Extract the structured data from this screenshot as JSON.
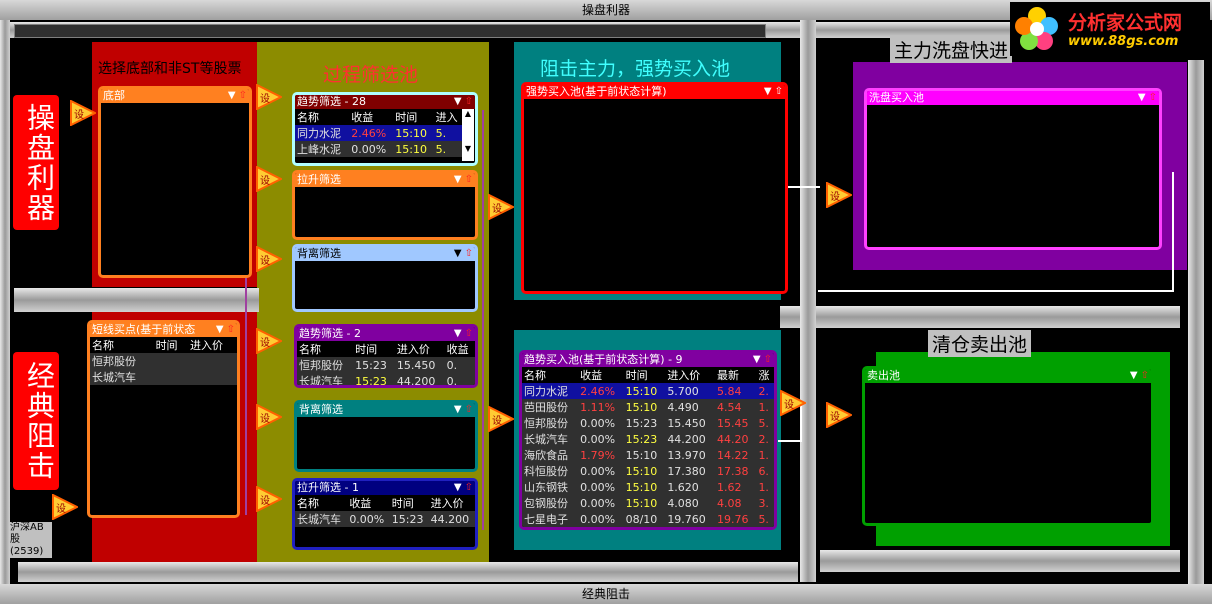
{
  "title": "操盘利器",
  "bottom_title": "经典阻击",
  "logo": {
    "text": "分析家公式网",
    "url": "www.88gs.com"
  },
  "side_labels": {
    "top": "操盘利器",
    "bottom": "经典阻击"
  },
  "section_titles": {
    "base": "选择底部和非ST等股票",
    "process": "过程筛选池",
    "strong": "阻击主力，强势买入池",
    "wash": "主力洗盘快进",
    "sell": "清仓卖出池"
  },
  "market_label": {
    "line1": "沪深AB股",
    "line2": "(2539)"
  },
  "node_label": "设",
  "windows": {
    "bottom": {
      "title": "底部"
    },
    "short_buy": {
      "title": "短线买点(基于前状态",
      "headers": [
        "名称",
        "时间",
        "进入价"
      ],
      "rows": [
        [
          "恒邦股份",
          "",
          ""
        ],
        [
          "长城汽车",
          "",
          ""
        ]
      ]
    },
    "trend1": {
      "title": "趋势筛选 - 28",
      "headers": [
        "名称",
        "收益",
        "时间",
        "进入"
      ],
      "rows": [
        [
          "同力水泥",
          "2.46%",
          "15:10",
          "5."
        ],
        [
          "上峰水泥",
          "0.00%",
          "15:10",
          "5."
        ]
      ]
    },
    "pull1": {
      "title": "拉升筛选"
    },
    "diverge1": {
      "title": "背离筛选"
    },
    "trend2": {
      "title": "趋势筛选 - 2",
      "headers": [
        "名称",
        "时间",
        "进入价",
        "收益"
      ],
      "rows": [
        [
          "恒邦股份",
          "15:23",
          "15.450",
          "0."
        ],
        [
          "长城汽车",
          "15:23",
          "44.200",
          "0."
        ]
      ]
    },
    "diverge2": {
      "title": "背离筛选"
    },
    "pull2": {
      "title": "拉升筛选 - 1",
      "headers": [
        "名称",
        "收益",
        "时间",
        "进入价"
      ],
      "rows": [
        [
          "长城汽车",
          "0.00%",
          "15:23",
          "44.200"
        ]
      ]
    },
    "strong_buy": {
      "title": "强势买入池(基于前状态计算)"
    },
    "trend_buy": {
      "title": "趋势买入池(基于前状态计算) - 9",
      "headers": [
        "名称",
        "收益",
        "时间",
        "进入价",
        "最新",
        "涨"
      ],
      "rows": [
        [
          "同力水泥",
          "2.46%",
          "15:10",
          "5.700",
          "5.84",
          "2."
        ],
        [
          "芭田股份",
          "1.11%",
          "15:10",
          "4.490",
          "4.54",
          "1."
        ],
        [
          "恒邦股份",
          "0.00%",
          "15:23",
          "15.450",
          "15.45",
          "5."
        ],
        [
          "长城汽车",
          "0.00%",
          "15:23",
          "44.200",
          "44.20",
          "2."
        ],
        [
          "海欣食品",
          "1.79%",
          "15:10",
          "13.970",
          "14.22",
          "1."
        ],
        [
          "科恒股份",
          "0.00%",
          "15:10",
          "17.380",
          "17.38",
          "6."
        ],
        [
          "山东钢铁",
          "0.00%",
          "15:10",
          "1.620",
          "1.62",
          "1."
        ],
        [
          "包钢股份",
          "0.00%",
          "15:10",
          "4.080",
          "4.08",
          "3."
        ],
        [
          "七星电子",
          "0.00%",
          "08/10",
          "19.760",
          "19.76",
          "5."
        ]
      ]
    },
    "wash_buy": {
      "title": "洗盘买入池"
    },
    "sell_pool": {
      "title": "卖出池"
    }
  },
  "colors": {
    "red": "#ff0000",
    "orange": "#ff8020",
    "olive": "#8c8c00",
    "teal": "#008080",
    "magenta": "#ff00ff",
    "purple": "#8000a0",
    "green": "#00a000",
    "navy": "#000080"
  }
}
